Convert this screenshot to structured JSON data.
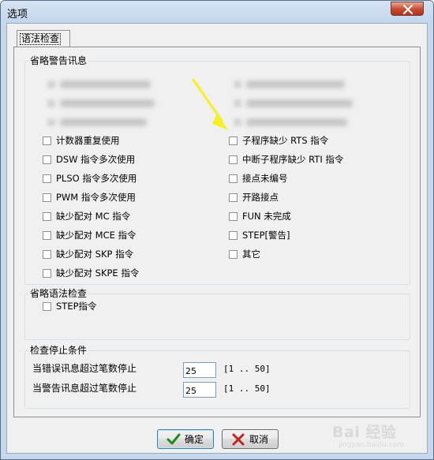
{
  "window": {
    "title": "选项",
    "close_icon": "close-x-icon"
  },
  "tab": {
    "label": "语法检查"
  },
  "group_warnings": {
    "title": "省略警告讯息",
    "left_items": [
      {
        "label": "计数器重复使用",
        "checked": false
      },
      {
        "label": "DSW 指令多次使用",
        "checked": false
      },
      {
        "label": "PLSO 指令多次使用",
        "checked": false
      },
      {
        "label": "PWM 指令多次使用",
        "checked": false
      },
      {
        "label": "缺少配对 MC 指令",
        "checked": false
      },
      {
        "label": "缺少配对 MCE 指令",
        "checked": false
      },
      {
        "label": "缺少配对 SKP 指令",
        "checked": false
      },
      {
        "label": "缺少配对 SKPE 指令",
        "checked": false
      }
    ],
    "right_items": [
      {
        "label": "子程序缺少 RTS 指令",
        "checked": false
      },
      {
        "label": "中断子程序缺少 RTI 指令",
        "checked": false
      },
      {
        "label": "接点未编号",
        "checked": false
      },
      {
        "label": "开路接点",
        "checked": false
      },
      {
        "label": "FUN 未完成",
        "checked": false
      },
      {
        "label": "STEP[警告]",
        "checked": false
      },
      {
        "label": "其它",
        "checked": false
      }
    ]
  },
  "group_syntax": {
    "title": "省略语法检查",
    "items": [
      {
        "label": "STEP指令",
        "checked": false
      }
    ]
  },
  "group_stop": {
    "title": "检查停止条件",
    "rows": [
      {
        "label": "当错误讯息超过笔数停止",
        "value": "25",
        "range": "[1 .. 50]"
      },
      {
        "label": "当警告讯息超过笔数停止",
        "value": "25",
        "range": "[1 .. 50]"
      }
    ]
  },
  "buttons": {
    "ok_label": "确定",
    "ok_icon": "checkmark-icon",
    "cancel_label": "取消",
    "cancel_icon": "x-mark-icon"
  },
  "annotation": {
    "arrow_color": "#f6ef21"
  },
  "watermark": {
    "text": "Bai 经验",
    "sub": "jingyan.baidu.com"
  }
}
